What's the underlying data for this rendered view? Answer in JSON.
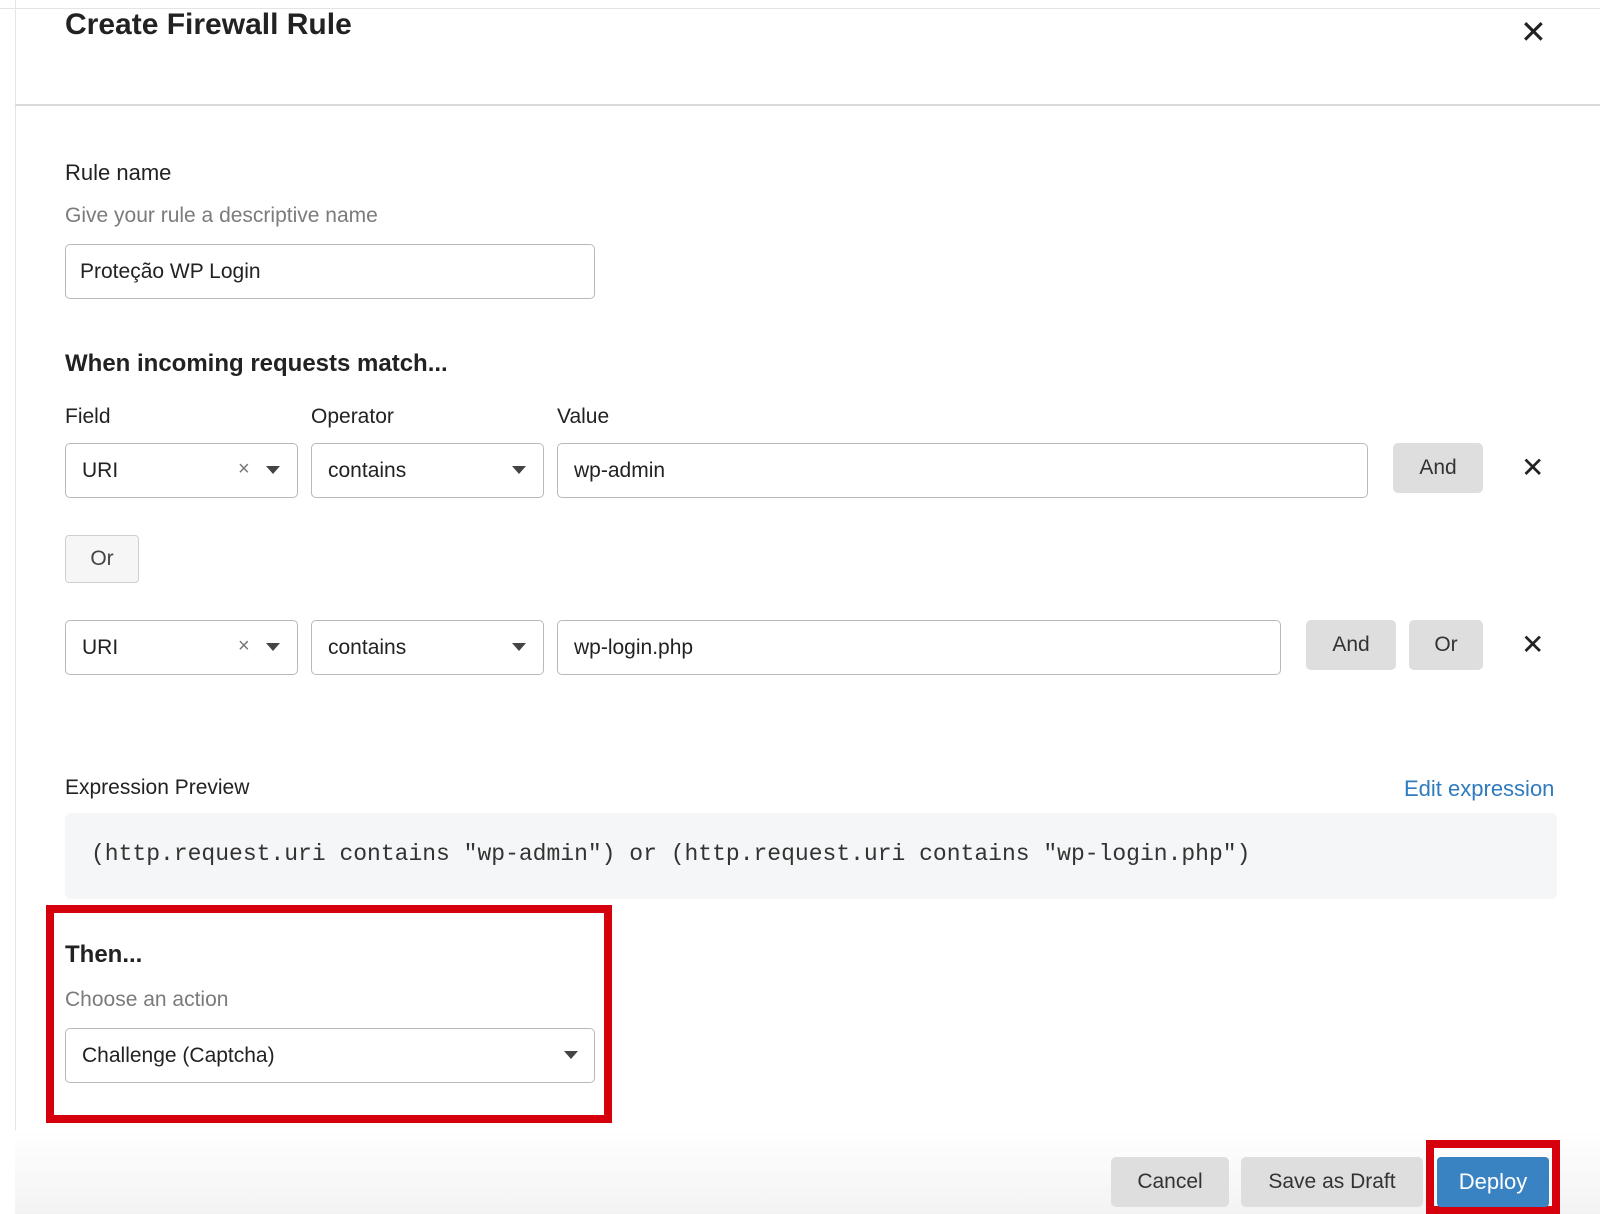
{
  "dialog": {
    "title": "Create Firewall Rule",
    "close_icon": "close-icon"
  },
  "rule_name": {
    "label": "Rule name",
    "hint": "Give your rule a descriptive name",
    "value": "Proteção WP Login"
  },
  "match": {
    "heading": "When incoming requests match...",
    "columns": {
      "field": "Field",
      "operator": "Operator",
      "value": "Value"
    },
    "rows": [
      {
        "field": "URI",
        "clear": "×",
        "operator": "contains",
        "value": "wp-admin",
        "and_label": "And",
        "remove_icon": "close-icon"
      },
      {
        "field": "URI",
        "clear": "×",
        "operator": "contains",
        "value": "wp-login.php",
        "and_label": "And",
        "or_label": "Or",
        "remove_icon": "close-icon"
      }
    ],
    "or_separator": "Or"
  },
  "expression": {
    "label": "Expression Preview",
    "edit_link": "Edit expression",
    "text": "(http.request.uri contains \"wp-admin\") or (http.request.uri contains \"wp-login.php\")"
  },
  "then": {
    "heading": "Then...",
    "hint": "Choose an action",
    "selected": "Challenge (Captcha)"
  },
  "footer": {
    "cancel": "Cancel",
    "save_draft": "Save as Draft",
    "deploy": "Deploy"
  },
  "colors": {
    "accent": "#3a83c3",
    "highlight": "#d5000b",
    "link": "#2f7bbf"
  }
}
